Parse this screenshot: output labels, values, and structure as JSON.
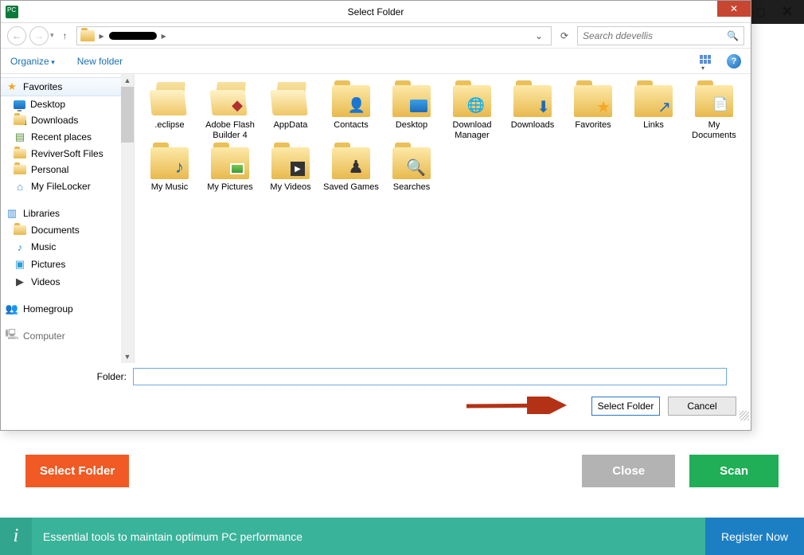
{
  "dialog": {
    "title": "Select Folder",
    "nav": {
      "search_placeholder": "Search ddevellis"
    },
    "toolbar": {
      "organize": "Organize",
      "new_folder": "New folder"
    },
    "tree": {
      "favorites_label": "Favorites",
      "favorites": [
        {
          "label": "Desktop",
          "icon": "monitor"
        },
        {
          "label": "Downloads",
          "icon": "folder-dn"
        },
        {
          "label": "Recent places",
          "icon": "recent"
        },
        {
          "label": "ReviverSoft Files",
          "icon": "folder"
        },
        {
          "label": "Personal",
          "icon": "folder"
        },
        {
          "label": "My FileLocker",
          "icon": "home"
        }
      ],
      "libraries_label": "Libraries",
      "libraries": [
        {
          "label": "Documents",
          "icon": "folder"
        },
        {
          "label": "Music",
          "icon": "music"
        },
        {
          "label": "Pictures",
          "icon": "pic"
        },
        {
          "label": "Videos",
          "icon": "vid"
        }
      ],
      "homegroup_label": "Homegroup",
      "computer_label": "Computer"
    },
    "folders": [
      {
        "label": ".eclipse",
        "type": "open"
      },
      {
        "label": "Adobe Flash Builder 4",
        "type": "open",
        "overlay": "flash"
      },
      {
        "label": "AppData",
        "type": "open"
      },
      {
        "label": "Contacts",
        "type": "closed",
        "overlay": "contact"
      },
      {
        "label": "Desktop",
        "type": "closed",
        "overlay": "monitor"
      },
      {
        "label": "Download Manager",
        "type": "closed",
        "overlay": "globe"
      },
      {
        "label": "Downloads",
        "type": "closed",
        "overlay": "dl"
      },
      {
        "label": "Favorites",
        "type": "closed",
        "overlay": "star"
      },
      {
        "label": "Links",
        "type": "closed",
        "overlay": "link"
      },
      {
        "label": "My Documents",
        "type": "closed",
        "overlay": "doc"
      },
      {
        "label": "My Music",
        "type": "closed",
        "overlay": "music"
      },
      {
        "label": "My Pictures",
        "type": "closed",
        "overlay": "pic"
      },
      {
        "label": "My Videos",
        "type": "closed",
        "overlay": "vid"
      },
      {
        "label": "Saved Games",
        "type": "closed",
        "overlay": "chess"
      },
      {
        "label": "Searches",
        "type": "closed",
        "overlay": "mag"
      }
    ],
    "folder_label": "Folder:",
    "folder_value": "",
    "select_btn": "Select Folder",
    "cancel_btn": "Cancel"
  },
  "app": {
    "select_folder_btn": "Select Folder",
    "close_btn": "Close",
    "scan_btn": "Scan"
  },
  "footer": {
    "message": "Essential tools to maintain optimum PC performance",
    "register": "Register Now"
  }
}
